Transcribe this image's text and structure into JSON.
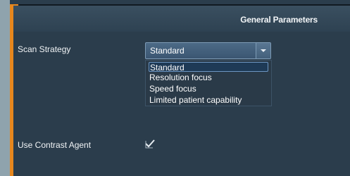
{
  "header": {
    "title": "General Parameters"
  },
  "scan_strategy": {
    "label": "Scan Strategy",
    "selected": "Standard",
    "options": [
      "Standard",
      "Resolution focus",
      "Speed focus",
      "Limited patient capability"
    ]
  },
  "contrast": {
    "label": "Use Contrast Agent",
    "checked": true
  },
  "colors": {
    "accent": "#e7871d",
    "panel": "#2b3d4c"
  }
}
